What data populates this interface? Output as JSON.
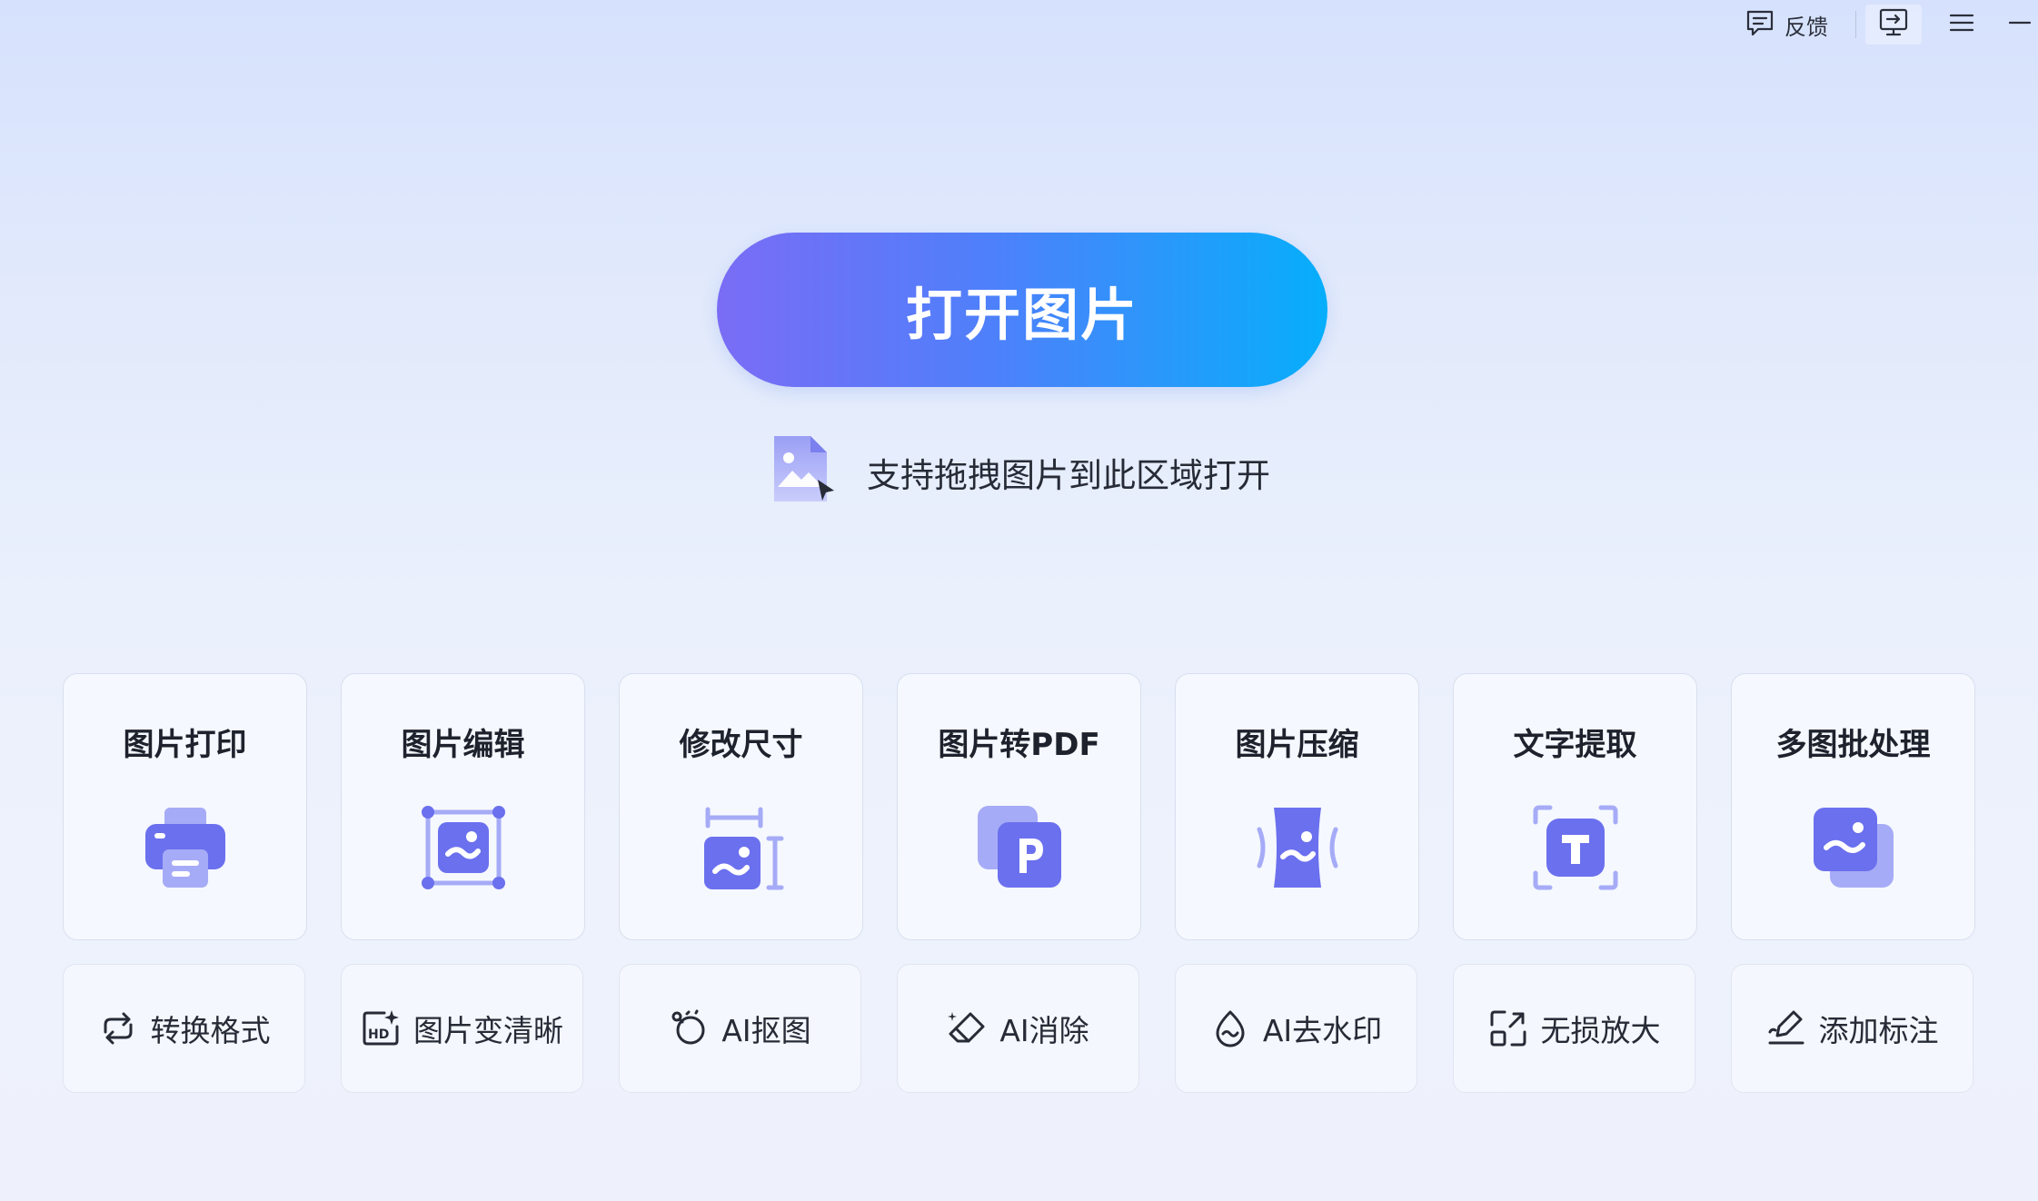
{
  "titlebar": {
    "feedback_label": "反馈",
    "icons": [
      "feedback-icon",
      "screen-cast-icon",
      "menu-icon",
      "minimize-icon"
    ]
  },
  "hero": {
    "open_button_label": "打开图片",
    "drop_hint": "支持拖拽图片到此区域打开",
    "accent_start": "#7a6cf5",
    "accent_end": "#06aefb"
  },
  "cards": [
    {
      "label": "图片打印",
      "icon": "printer-icon"
    },
    {
      "label": "图片编辑",
      "icon": "image-edit-icon"
    },
    {
      "label": "修改尺寸",
      "icon": "resize-icon"
    },
    {
      "label": "图片转PDF",
      "icon": "pdf-icon"
    },
    {
      "label": "图片压缩",
      "icon": "compress-icon"
    },
    {
      "label": "文字提取",
      "icon": "text-extract-icon"
    },
    {
      "label": "多图批处理",
      "icon": "batch-icon"
    }
  ],
  "tools": [
    {
      "label": "转换格式",
      "icon": "convert-icon"
    },
    {
      "label": "图片变清晰",
      "icon": "hd-icon"
    },
    {
      "label": "AI抠图",
      "icon": "cutout-icon"
    },
    {
      "label": "AI消除",
      "icon": "eraser-icon"
    },
    {
      "label": "AI去水印",
      "icon": "watermark-icon"
    },
    {
      "label": "无损放大",
      "icon": "enlarge-icon"
    },
    {
      "label": "添加标注",
      "icon": "annotate-icon"
    }
  ],
  "colors": {
    "icon_primary": "#6b70ee",
    "icon_light": "#a6abf7"
  }
}
